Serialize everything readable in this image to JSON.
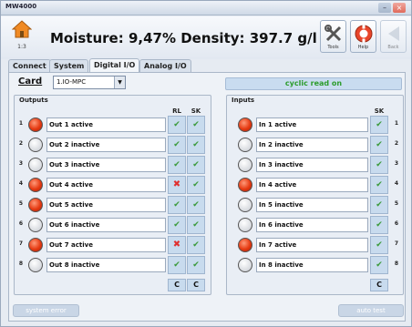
{
  "window": {
    "title": "MW4000"
  },
  "header": {
    "home_label": "1:3",
    "headline": "Moisture: 9,47%   Density: 397.7 g/l",
    "tools_label": "Tools",
    "help_label": "Help",
    "back_label": "Back"
  },
  "tabs": [
    {
      "label": "Connect"
    },
    {
      "label": "System"
    },
    {
      "label": "Digital I/O"
    },
    {
      "label": "Analog I/O"
    }
  ],
  "active_tab": "Digital I/O",
  "card": {
    "label": "Card",
    "value": "1.IO-MPC"
  },
  "status": {
    "cyclic": "cyclic read on",
    "cyclic_color": "#2c9c2c"
  },
  "outputs": {
    "title": "Outputs",
    "col_rl": "RL",
    "col_sk": "SK",
    "rows": [
      {
        "num": "1",
        "label": "Out 1 active",
        "on": true,
        "rl": "check",
        "sk": "check"
      },
      {
        "num": "2",
        "label": "Out 2 inactive",
        "on": false,
        "rl": "check",
        "sk": "check"
      },
      {
        "num": "3",
        "label": "Out 3 inactive",
        "on": false,
        "rl": "check",
        "sk": "check"
      },
      {
        "num": "4",
        "label": "Out 4 active",
        "on": true,
        "rl": "error",
        "sk": "check"
      },
      {
        "num": "5",
        "label": "Out 5 active",
        "on": true,
        "rl": "check",
        "sk": "check"
      },
      {
        "num": "6",
        "label": "Out 6 inactive",
        "on": false,
        "rl": "check",
        "sk": "check"
      },
      {
        "num": "7",
        "label": "Out 7 active",
        "on": true,
        "rl": "error",
        "sk": "check"
      },
      {
        "num": "8",
        "label": "Out 8 inactive",
        "on": false,
        "rl": "check",
        "sk": "check"
      }
    ],
    "clear_rl": "C",
    "clear_sk": "C"
  },
  "inputs": {
    "title": "Inputs",
    "col_sk": "SK",
    "rows": [
      {
        "num": "1",
        "label": "In 1 active",
        "on": true,
        "sk": "check"
      },
      {
        "num": "2",
        "label": "In 2 inactive",
        "on": false,
        "sk": "check"
      },
      {
        "num": "3",
        "label": "In 3 inactive",
        "on": false,
        "sk": "check"
      },
      {
        "num": "4",
        "label": "In 4 active",
        "on": true,
        "sk": "check"
      },
      {
        "num": "5",
        "label": "In 5 inactive",
        "on": false,
        "sk": "check"
      },
      {
        "num": "6",
        "label": "In 6 inactive",
        "on": false,
        "sk": "check"
      },
      {
        "num": "7",
        "label": "In 7 active",
        "on": true,
        "sk": "check"
      },
      {
        "num": "8",
        "label": "In 8 inactive",
        "on": false,
        "sk": "check"
      }
    ],
    "clear_sk": "C"
  },
  "footer": {
    "system_error": "system error",
    "auto_test": "auto test"
  },
  "colors": {
    "led_on": "#e53a12",
    "check": "#3a9a3a",
    "error": "#e03030",
    "accent": "#c8dbee"
  }
}
